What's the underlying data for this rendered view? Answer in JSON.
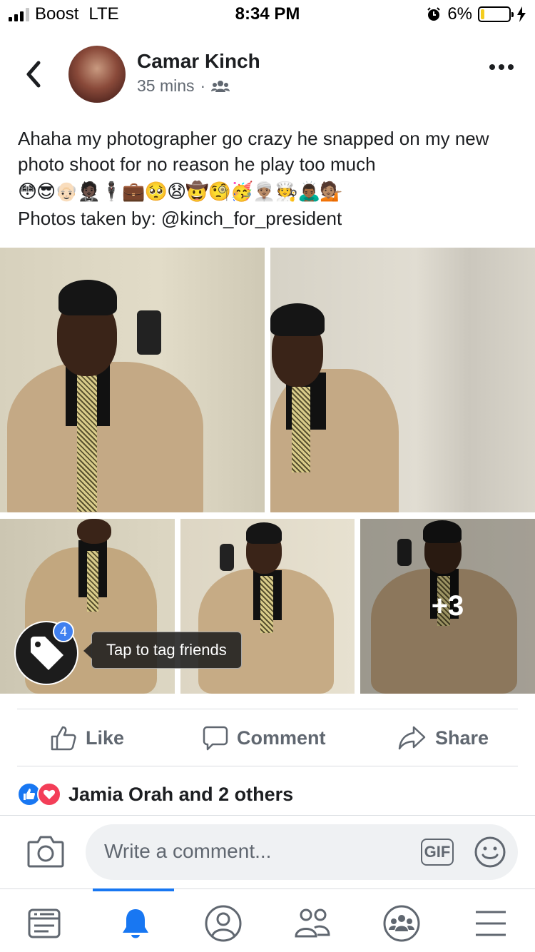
{
  "status_bar": {
    "carrier": "Boost",
    "network": "LTE",
    "time": "8:34 PM",
    "battery_percent": "6%",
    "battery_level": 0.06,
    "battery_color": "#f4cd1e"
  },
  "post": {
    "author": "Camar Kinch",
    "time_ago": "35 mins",
    "audience_icon": "friends-icon",
    "text": "Ahaha my photographer go crazy he snapped on my new photo shoot for no reason he play too much",
    "emojis": "😳😎👴🏻🤵🏿🕴🏿💼🥺😧🤠🧐🥳👳🏽‍♂️🧑‍🍳🙇🏾‍♂️💁🏽",
    "credit": "Photos taken by: @kinch_for_president",
    "extra_photos": "+3",
    "tag_count": "4",
    "tag_tip": "Tap to tag friends"
  },
  "actions": {
    "like": "Like",
    "comment": "Comment",
    "share": "Share"
  },
  "reactions": {
    "summary": "Jamia Orah and 2 others"
  },
  "composer": {
    "placeholder": "Write a comment...",
    "gif": "GIF"
  },
  "bottom_nav": {
    "items": [
      "news-feed-icon",
      "notifications-bell-icon",
      "profile-icon",
      "friends-icon",
      "groups-icon",
      "menu-icon"
    ],
    "active_index": 1,
    "accent": "#1877f2"
  }
}
